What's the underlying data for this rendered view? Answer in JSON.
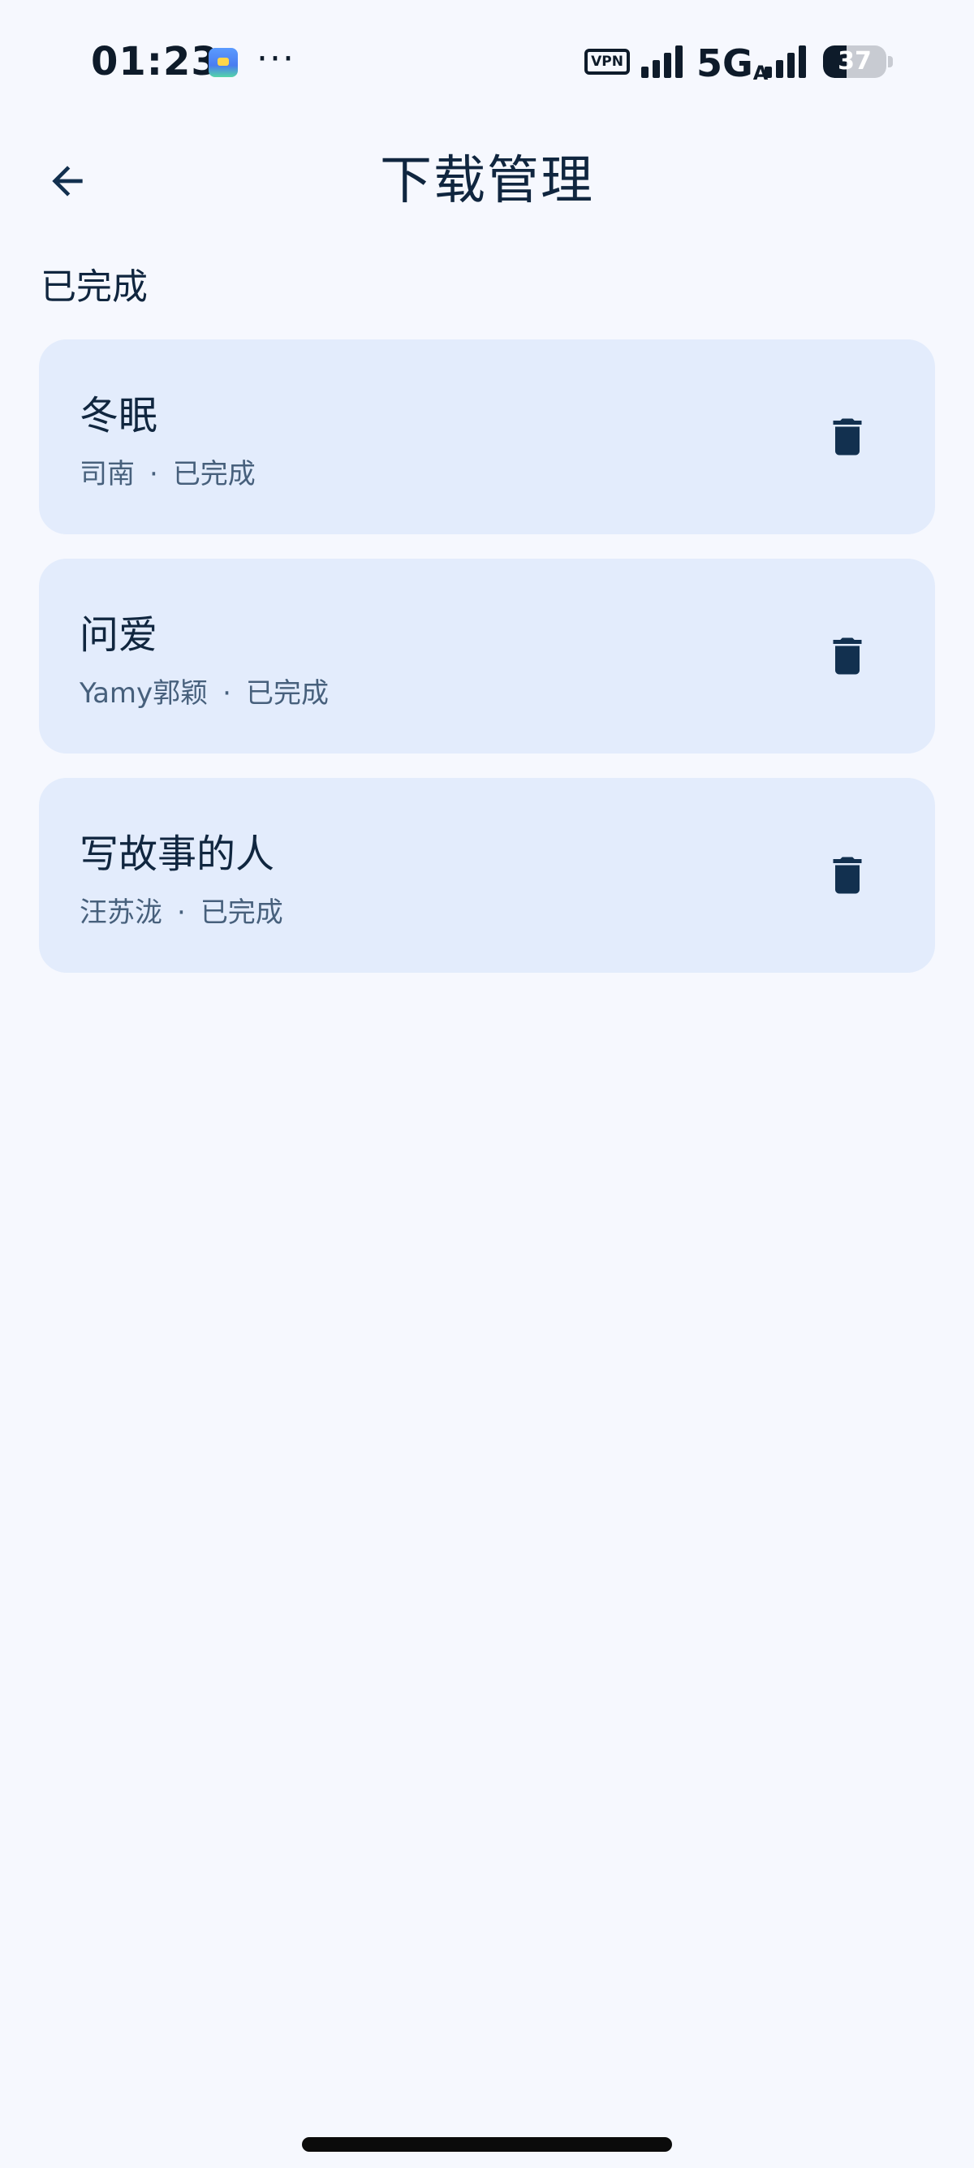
{
  "status_bar": {
    "time": "01:23",
    "more_indicator": "···",
    "vpn_label": "VPN",
    "network": "5G",
    "network_sub": "A",
    "battery_level": "37",
    "battery_fraction": 0.37,
    "icons": [
      "app-notification-icon",
      "vpn-icon",
      "signal-icon",
      "signal-icon",
      "battery-icon"
    ]
  },
  "header": {
    "back_icon": "arrow-left-icon",
    "title": "下载管理"
  },
  "section": {
    "title": "已完成"
  },
  "downloads": [
    {
      "title": "冬眠",
      "artist": "司南",
      "separator": "·",
      "status": "已完成",
      "action_icon": "trash-icon"
    },
    {
      "title": "问爱",
      "artist": "Yamy郭颖",
      "separator": "·",
      "status": "已完成",
      "action_icon": "trash-icon"
    },
    {
      "title": "写故事的人",
      "artist": "汪苏泷",
      "separator": "·",
      "status": "已完成",
      "action_icon": "trash-icon"
    }
  ],
  "colors": {
    "background": "#F6F8FE",
    "card": "#E3ECFC",
    "primary_text": "#10263F",
    "secondary_text": "#47607C",
    "icon": "#12304F"
  }
}
